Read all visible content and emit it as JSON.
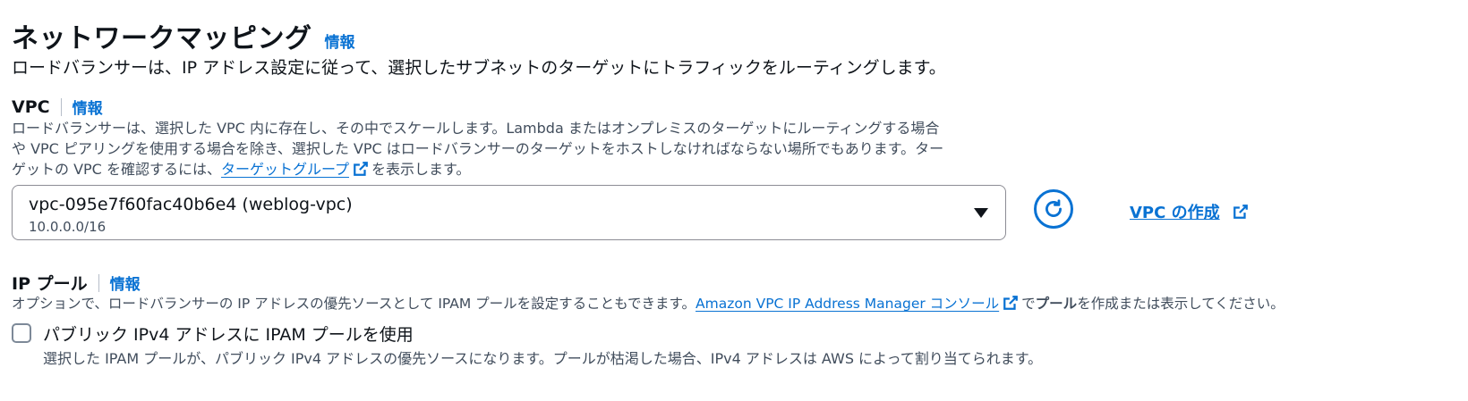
{
  "section": {
    "title": "ネットワークマッピング",
    "info": "情報",
    "description": "ロードバランサーは、IP アドレス設定に従って、選択したサブネットのターゲットにトラフィックをルーティングします。"
  },
  "vpc": {
    "label": "VPC",
    "info": "情報",
    "desc_line1": "ロードバランサーは、選択した VPC 内に存在し、その中でスケールします。Lambda またはオンプレミスのターゲットにルーティングする場合",
    "desc_line2": "や VPC ピアリングを使用する場合を除き、選択した VPC はロードバランサーのターゲットをホストしなければならない場所でもあります。ター",
    "desc_line3_prefix": "ゲットの VPC を確認するには、",
    "desc_link": "ターゲットグループ",
    "desc_line3_suffix": "を表示します。",
    "selected_value": "vpc-095e7f60fac40b6e4 (weblog-vpc)",
    "selected_cidr": "10.0.0.0/16",
    "create_label": "VPC の作成"
  },
  "ip_pool": {
    "label": "IP プール",
    "info": "情報",
    "desc_prefix": "オプションで、ロードバランサーの IP アドレスの優先ソースとして IPAM プールを設定することもできます。",
    "desc_link": "Amazon VPC IP Address Manager コンソール",
    "desc_mid": "で",
    "desc_bold": "プール",
    "desc_suffix": "を作成または表示してください。",
    "checkbox_label": "パブリック IPv4 アドレスに IPAM プールを使用",
    "checkbox_checked": false,
    "checkbox_desc": "選択した IPAM プールが、パブリック IPv4 アドレスの優先ソースになります。プールが枯渇した場合、IPv4 アドレスは AWS によって割り当てられます。"
  },
  "icons": {
    "external": "external-link-icon",
    "refresh": "refresh-icon",
    "caret": "caret-down-icon"
  },
  "colors": {
    "link": "#0972d3",
    "text": "#0f141a",
    "secondary_text": "#414d5c"
  }
}
